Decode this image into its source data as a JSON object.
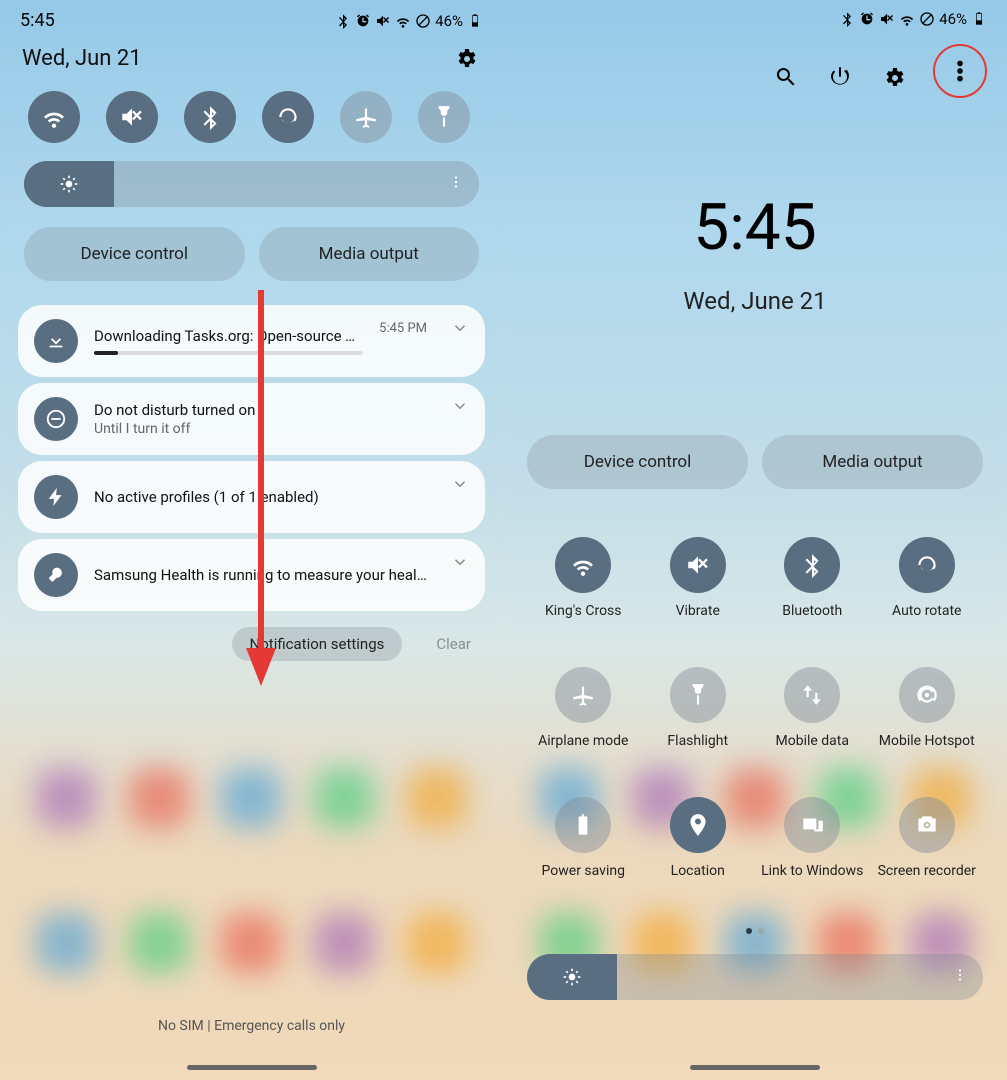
{
  "status": {
    "time": "5:45",
    "battery": "46%"
  },
  "left": {
    "date": "Wed, Jun 21",
    "device_control": "Device control",
    "media_output": "Media output",
    "notifications": [
      {
        "title": "Downloading Tasks.org: Open-source To-Do Lists &...",
        "time": "5:45 PM",
        "has_progress": true
      },
      {
        "title": "Do not disturb turned on",
        "sub": "Until I turn it off"
      },
      {
        "title": "No active profiles (1 of 1 enabled)"
      },
      {
        "title": "Samsung Health is running to measure your health data."
      }
    ],
    "notification_settings": "Notification settings",
    "clear": "Clear",
    "bottom": "No SIM | Emergency calls only"
  },
  "right": {
    "big_time": "5:45",
    "big_date": "Wed, June 21",
    "device_control": "Device control",
    "media_output": "Media output",
    "tiles": [
      {
        "label": "King's Cross",
        "on": true
      },
      {
        "label": "Vibrate",
        "on": true
      },
      {
        "label": "Bluetooth",
        "on": true
      },
      {
        "label": "Auto rotate",
        "on": true
      },
      {
        "label": "Airplane mode",
        "on": false
      },
      {
        "label": "Flashlight",
        "on": false
      },
      {
        "label": "Mobile data",
        "on": false
      },
      {
        "label": "Mobile Hotspot",
        "on": false
      },
      {
        "label": "Power saving",
        "on": false
      },
      {
        "label": "Location",
        "on": true
      },
      {
        "label": "Link to Windows",
        "on": false
      },
      {
        "label": "Screen recorder",
        "on": false
      }
    ]
  }
}
